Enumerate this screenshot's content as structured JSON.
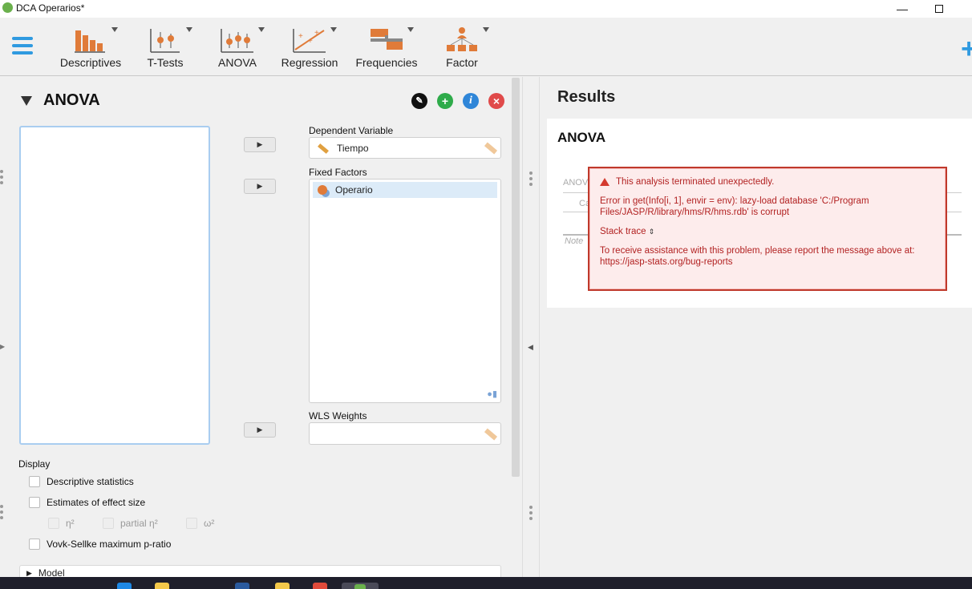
{
  "window": {
    "title": "DCA Operarios*",
    "minimize_icon": "minimize-icon",
    "maximize_icon": "maximize-icon"
  },
  "ribbon": {
    "buttons": [
      {
        "label": "Descriptives",
        "icon": "bar-chart-icon"
      },
      {
        "label": "T-Tests",
        "icon": "ttest-icon"
      },
      {
        "label": "ANOVA",
        "icon": "anova-icon"
      },
      {
        "label": "Regression",
        "icon": "regression-icon"
      },
      {
        "label": "Frequencies",
        "icon": "frequencies-icon"
      },
      {
        "label": "Factor",
        "icon": "factor-icon"
      }
    ],
    "add_icon": "plus-icon",
    "accent": "#2f9ae0"
  },
  "analysis": {
    "title": "ANOVA",
    "edit_icon": "pencil-icon",
    "duplicate_icon": "plus-circle-icon",
    "info_icon": "info-icon",
    "close_icon": "close-icon",
    "dependent_label": "Dependent Variable",
    "dependent_value": "Tiempo",
    "fixed_factors_label": "Fixed Factors",
    "fixed_factors": [
      "Operario"
    ],
    "wls_label": "WLS Weights",
    "display_label": "Display",
    "options": {
      "descriptive": "Descriptive statistics",
      "effect_size": "Estimates of effect size",
      "eta": "η²",
      "partial_eta": "partial η²",
      "omega": "ω²",
      "vovk": "Vovk-Sellke maximum p-ratio"
    },
    "model_section": "Model"
  },
  "results": {
    "title": "Results",
    "card_title": "ANOVA",
    "ghost_anova": "ANOV",
    "ghost_c": "Ca",
    "ghost_note": "Note",
    "error": {
      "headline": "This analysis terminated unexpectedly.",
      "message": "Error in get(Info[i, 1], envir = env): lazy-load database 'C:/Program Files/JASP/R/library/hms/R/hms.rdb' is corrupt",
      "stack_trace": "Stack trace",
      "help": "To receive assistance with this problem, please report the message above at:",
      "link": "https://jasp-stats.org/bug-reports"
    },
    "error_color": "#c0392b"
  }
}
